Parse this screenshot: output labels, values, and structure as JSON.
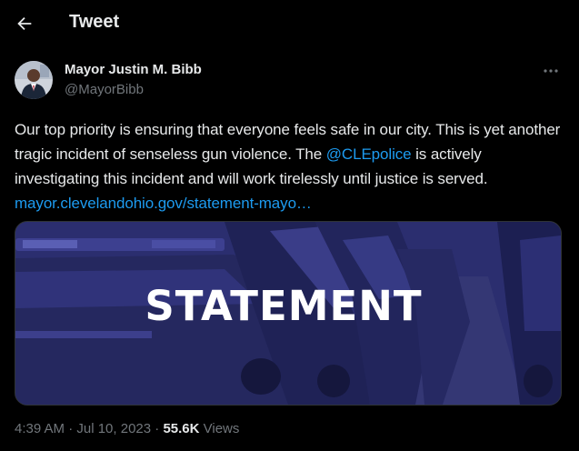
{
  "header": {
    "title": "Tweet"
  },
  "tweet": {
    "author_name": "Mayor Justin M. Bibb",
    "author_handle": "@MayorBibb",
    "text_part1": "Our top priority is ensuring that everyone feels safe in our city. This is yet another tragic incident of senseless gun violence. The ",
    "mention": "@CLEpolice",
    "text_part2": " is actively investigating this incident and will work tirelessly until justice is served. ",
    "link": "mayor.clevelandohio.gov/statement-mayo…",
    "media_text": "STATEMENT",
    "time": "4:39 AM · Jul 10, 2023",
    "separator": " · ",
    "views_count": "55.6K",
    "views_label": " Views"
  },
  "colors": {
    "background": "#000000",
    "text": "#e7e9ea",
    "secondary": "#71767b",
    "link": "#1d9bf0",
    "media_overlay": "#2a2d6e"
  },
  "icons": {
    "back": "arrow-left-icon",
    "more": "more-horizontal-icon"
  }
}
